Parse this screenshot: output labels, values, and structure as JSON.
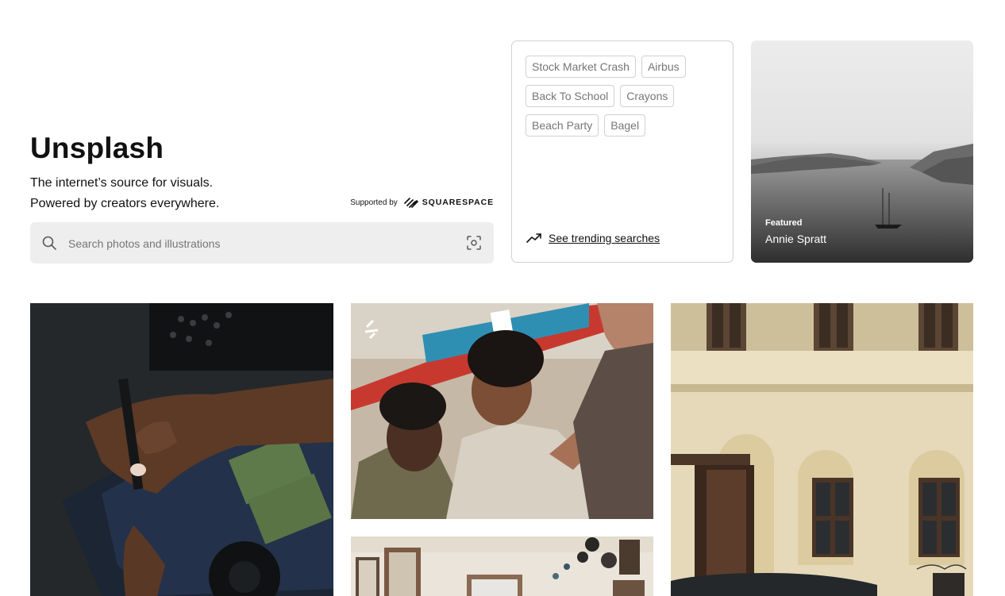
{
  "hero": {
    "title": "Unsplash",
    "tagline_line1": "The internet’s source for visuals.",
    "tagline_line2": "Powered by creators everywhere.",
    "supported_by": "Supported by",
    "sponsor_name": "SQUARESPACE",
    "search_placeholder": "Search photos and illustrations"
  },
  "trending": {
    "tags": [
      [
        "Stock Market Crash",
        "Airbus"
      ],
      [
        "Back To School",
        "Crayons"
      ],
      [
        "Beach Party",
        "Bagel"
      ]
    ],
    "see_trending_label": "See trending searches",
    "icon": "trending-up-icon"
  },
  "featured": {
    "label": "Featured",
    "author": "Annie Spratt"
  },
  "icons": {
    "search": "search-icon",
    "visual_search": "visual-search-icon",
    "sponsor_logo": "squarespace-logo-icon"
  }
}
